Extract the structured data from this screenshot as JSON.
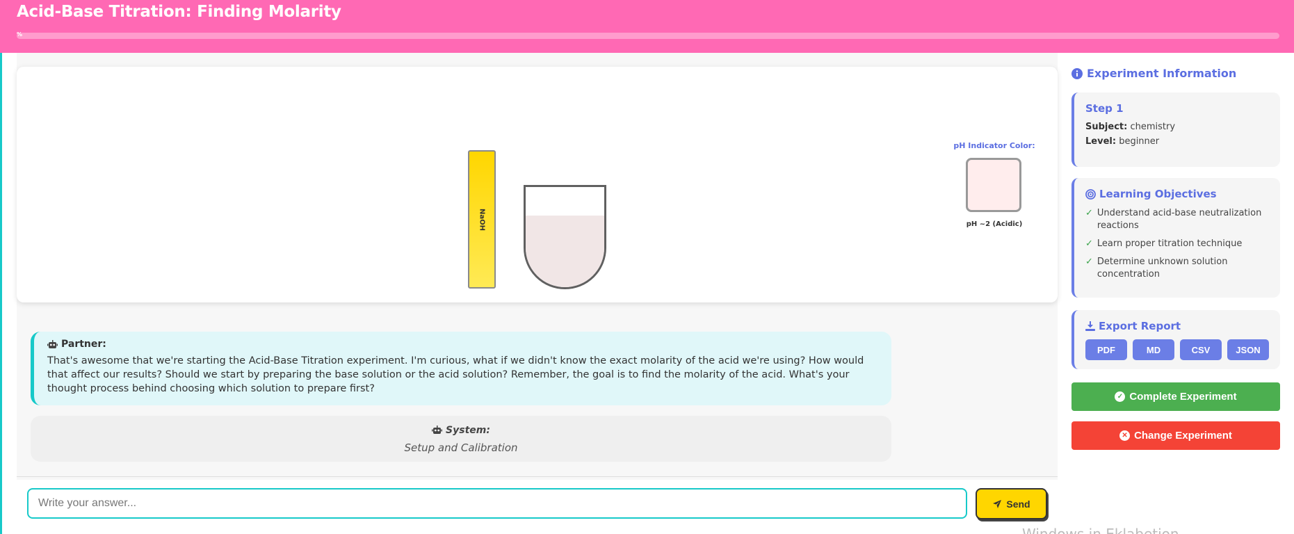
{
  "header": {
    "title": "Acid-Base Titration: Finding Molarity",
    "progress_text": "%",
    "progress_fraction": 0.0
  },
  "lab": {
    "burette_label": "NaOH",
    "ph_indicator_title": "pH Indicator Color:",
    "ph_value_text": "pH ~2 (Acidic)",
    "colors": {
      "burette": "#ffd600",
      "flask_liquid": "#f1e6e6",
      "ph_swatch": "#ffeded"
    }
  },
  "chat": {
    "partner": {
      "sender": "Partner:",
      "text": "That's awesome that we're starting the Acid-Base Titration experiment. I'm curious, what if we didn't know the exact molarity of the acid we're using? How would that affect our results? Should we start by preparing the base solution or the acid solution? Remember, the goal is to find the molarity of the acid. What's your thought process behind choosing which solution to prepare first?"
    },
    "system": {
      "sender": "System:",
      "text": "Setup and Calibration"
    },
    "input": {
      "placeholder": "Write your answer...",
      "value": ""
    },
    "send_label": "Send"
  },
  "sidebar": {
    "title": "Experiment Information",
    "step": {
      "title": "Step 1",
      "subject_key": "Subject:",
      "subject_value": "chemistry",
      "level_key": "Level:",
      "level_value": "beginner"
    },
    "objectives": {
      "title": "Learning Objectives",
      "items": [
        "Understand acid-base neutralization reactions",
        "Learn proper titration technique",
        "Determine unknown solution concentration"
      ]
    },
    "export": {
      "title": "Export Report",
      "buttons": [
        "PDF",
        "MD",
        "CSV",
        "JSON"
      ]
    },
    "complete_label": "Complete Experiment",
    "change_label": "Change Experiment",
    "colors": {
      "accent": "#5b6ee1",
      "complete": "#4caf50",
      "change": "#f44336"
    }
  },
  "watermark": "Windows in Eklabetion"
}
